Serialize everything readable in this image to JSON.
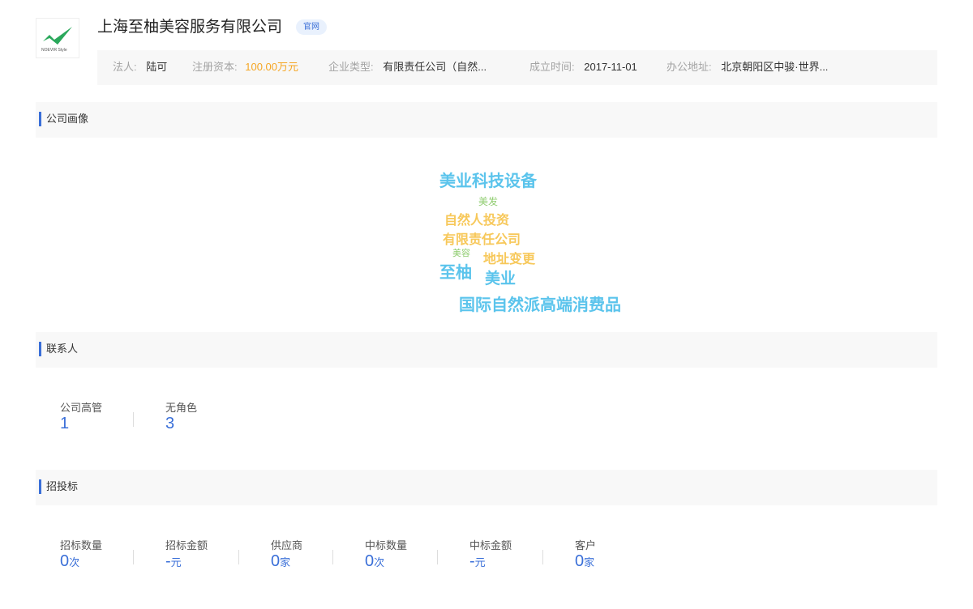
{
  "company": {
    "logo_text": "NOEVIR Style",
    "name": "上海至柚美容服务有限公司",
    "badge": "官网"
  },
  "info": {
    "legal_rep_label": "法人:",
    "legal_rep": "陆可",
    "capital_label": "注册资本:",
    "capital": "100.00万元",
    "type_label": "企业类型:",
    "type": "有限责任公司（自然...",
    "founded_label": "成立时间:",
    "founded": "2017-11-01",
    "address_label": "办公地址:",
    "address": "北京朝阳区中骏·世界..."
  },
  "sections": {
    "portrait": "公司画像",
    "contacts": "联系人",
    "bidding": "招投标"
  },
  "word_cloud": [
    {
      "text": "美业科技设备"
    },
    {
      "text": "美发"
    },
    {
      "text": "自然人投资"
    },
    {
      "text": "有限责任公司"
    },
    {
      "text": "美容"
    },
    {
      "text": "地址变更"
    },
    {
      "text": "至柚"
    },
    {
      "text": "美业"
    },
    {
      "text": "国际自然派高端消费品"
    }
  ],
  "contacts": [
    {
      "label": "公司高管",
      "value": "1"
    },
    {
      "label": "无角色",
      "value": "3"
    }
  ],
  "bidding": [
    {
      "label": "招标数量",
      "value": "0",
      "unit": "次"
    },
    {
      "label": "招标金额",
      "value": "-",
      "unit": "元"
    },
    {
      "label": "供应商",
      "value": "0",
      "unit": "家"
    },
    {
      "label": "中标数量",
      "value": "0",
      "unit": "次"
    },
    {
      "label": "中标金额",
      "value": "-",
      "unit": "元"
    },
    {
      "label": "客户",
      "value": "0",
      "unit": "家"
    }
  ],
  "colors": {
    "accent": "#3a6fd8",
    "orange": "#f5a623",
    "cloud_blue": "#5bc4ec",
    "cloud_orange": "#f7c85a",
    "cloud_green": "#8fcc6f"
  }
}
